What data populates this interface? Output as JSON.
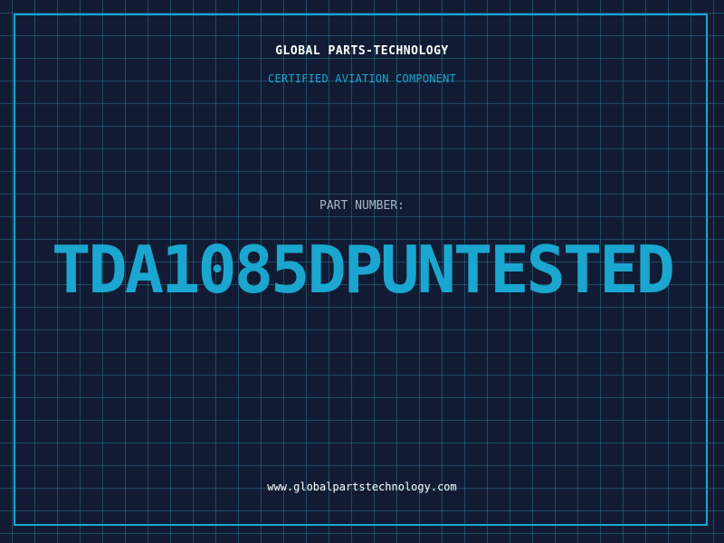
{
  "header": {
    "company": "GLOBAL PARTS-TECHNOLOGY",
    "subtitle": "CERTIFIED AVIATION COMPONENT"
  },
  "part": {
    "label": "PART NUMBER:",
    "number": "TDA1085DPUNTESTED"
  },
  "footer": {
    "website": "www.globalpartstechnology.com"
  },
  "colors": {
    "background": "#111c34",
    "accent": "#1aa6cf",
    "grid": "#286e8c",
    "text_primary": "#ffffff",
    "text_muted": "#a8b7c9"
  }
}
